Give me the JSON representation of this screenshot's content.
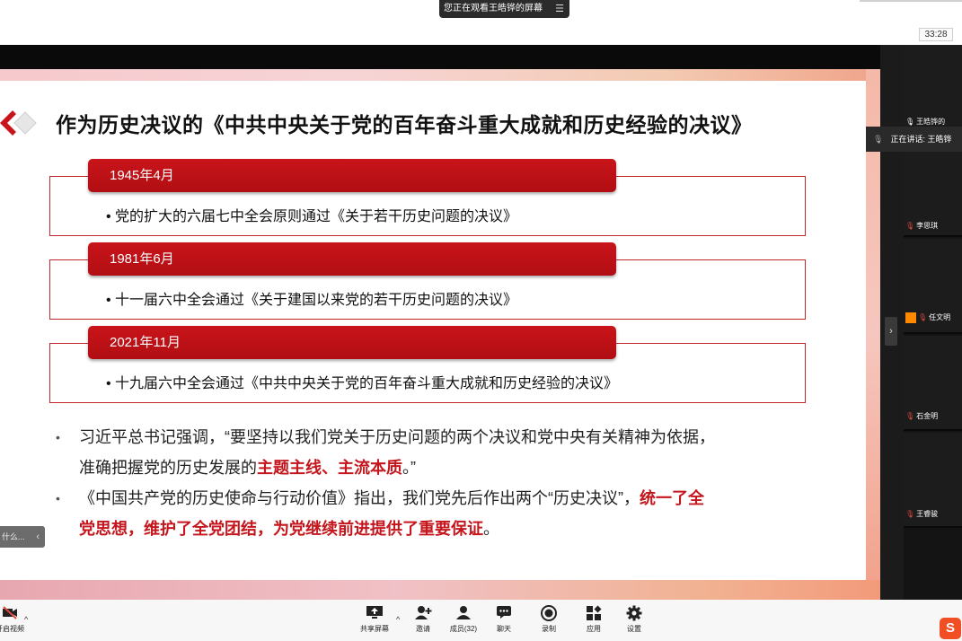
{
  "share_banner": {
    "text": "您正在观看王皓铧的屏幕",
    "menu_icon": "menu-icon"
  },
  "timer": "33:28",
  "slide": {
    "title": "作为历史决议的《中共中央关于党的百年奋斗重大成就和历史经验的决议》",
    "events": [
      {
        "date": "1945年4月",
        "text": "• 党的扩大的六届七中全会原则通过《关于若干历史问题的决议》"
      },
      {
        "date": "1981年6月",
        "text": "• 十一届六中全会通过《关于建国以来党的若干历史问题的决议》"
      },
      {
        "date": "2021年11月",
        "text": "• 十九届六中全会通过《中共中央关于党的百年奋斗重大成就和历史经验的决议》"
      }
    ],
    "bullets": [
      {
        "dot": "•",
        "line1": "习近平总书记强调，“要坚持以我们党关于历史问题的两个决议和党中央有关精神为依据，",
        "line2_prefix": "准确把握党的历史发展的",
        "line2_highlight": "主题主线、主流本质",
        "line2_suffix": "。”"
      },
      {
        "dot": "•",
        "line1_prefix": "《中国共产党的历史使命与行动价值》指出，我们党先后作出两个“历史决议”，",
        "line1_highlight": "统一了全",
        "line2_highlight": "党思想，维护了全党团结，为党继续前进提供了重要保证",
        "line2_suffix": "。"
      }
    ],
    "accent_color": "#c4161c"
  },
  "mini_tab": {
    "text": "什么...",
    "arrow": "‹"
  },
  "participants": {
    "speaking_label": "正在讲话: 王皓铧",
    "tiles": [
      {
        "name": "王皓铧的"
      },
      {
        "name": "李思琪"
      },
      {
        "name": "任文明"
      },
      {
        "name": "石金明"
      },
      {
        "name": "王睿骏"
      }
    ],
    "collapse_arrow": "›"
  },
  "toolbar": {
    "video_label": "开启视频",
    "share_label": "共享屏幕",
    "invite_label": "邀请",
    "members_label": "成员(32)",
    "chat_label": "聊天",
    "record_label": "录制",
    "apps_label": "应用",
    "settings_label": "设置",
    "caret": "^"
  },
  "ime_logo": "S"
}
